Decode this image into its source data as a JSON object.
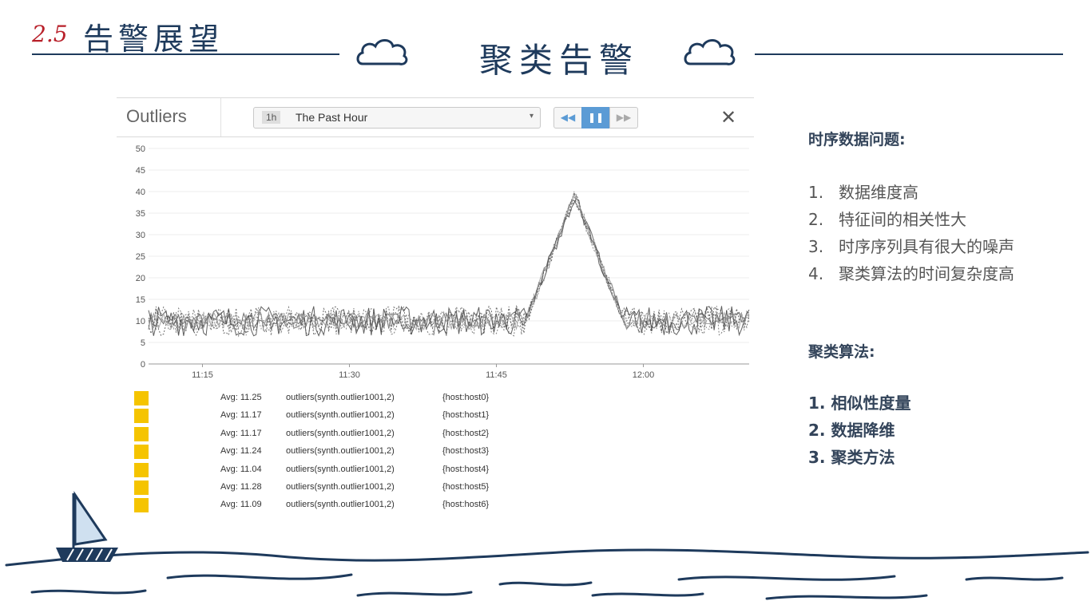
{
  "header": {
    "section_number": "2.5",
    "section_title": "告警展望",
    "main_title": "聚类告警"
  },
  "panel": {
    "title": "Outliers",
    "range_badge": "1h",
    "range_label": "The Past Hour",
    "range_caret": "▾",
    "rewind_icon": "◀◀",
    "pause_icon": "❚❚",
    "forward_icon": "▶▶",
    "close_icon": "✕"
  },
  "chart_data": {
    "type": "line",
    "ylim": [
      0,
      50
    ],
    "yticks": [
      "0",
      "5",
      "10",
      "15",
      "20",
      "25",
      "30",
      "35",
      "40",
      "45",
      "50"
    ],
    "xticks": [
      "11:15",
      "11:30",
      "11:45",
      "12:00"
    ],
    "grid": true,
    "series": [
      {
        "color": "#555555"
      },
      {
        "color": "#666666"
      },
      {
        "color": "#777777"
      },
      {
        "color": "#444444"
      },
      {
        "color": "#888888"
      },
      {
        "color": "#505050"
      },
      {
        "color": "#999999"
      }
    ],
    "baseline": 10,
    "peak": 39,
    "peak_time": "11:53"
  },
  "legend": [
    {
      "avg": "Avg: 11.25",
      "query": "outliers(synth.outlier1001,2)",
      "host": "{host:host0}"
    },
    {
      "avg": "Avg: 11.17",
      "query": "outliers(synth.outlier1001,2)",
      "host": "{host:host1}"
    },
    {
      "avg": "Avg: 11.17",
      "query": "outliers(synth.outlier1001,2)",
      "host": "{host:host2}"
    },
    {
      "avg": "Avg: 11.24",
      "query": "outliers(synth.outlier1001,2)",
      "host": "{host:host3}"
    },
    {
      "avg": "Avg: 11.04",
      "query": "outliers(synth.outlier1001,2)",
      "host": "{host:host4}"
    },
    {
      "avg": "Avg: 11.28",
      "query": "outliers(synth.outlier1001,2)",
      "host": "{host:host5}"
    },
    {
      "avg": "Avg: 11.09",
      "query": "outliers(synth.outlier1001,2)",
      "host": "{host:host6}"
    }
  ],
  "right": {
    "heading1": "时序数据问题:",
    "problems": [
      {
        "num": "1.",
        "text": "数据维度高"
      },
      {
        "num": "2.",
        "text": "特征间的相关性大"
      },
      {
        "num": "3.",
        "text": "时序序列具有很大的噪声"
      },
      {
        "num": "4.",
        "text": "聚类算法的时间复杂度高"
      }
    ],
    "heading2": "聚类算法:",
    "methods": [
      "1. 相似性度量",
      "2. 数据降维",
      "3. 聚类方法"
    ]
  },
  "colors": {
    "accent": "#1e3a5c",
    "section_red": "#b8202a",
    "legend_swatch": "#f5c400",
    "button_blue": "#5b9bd5"
  }
}
